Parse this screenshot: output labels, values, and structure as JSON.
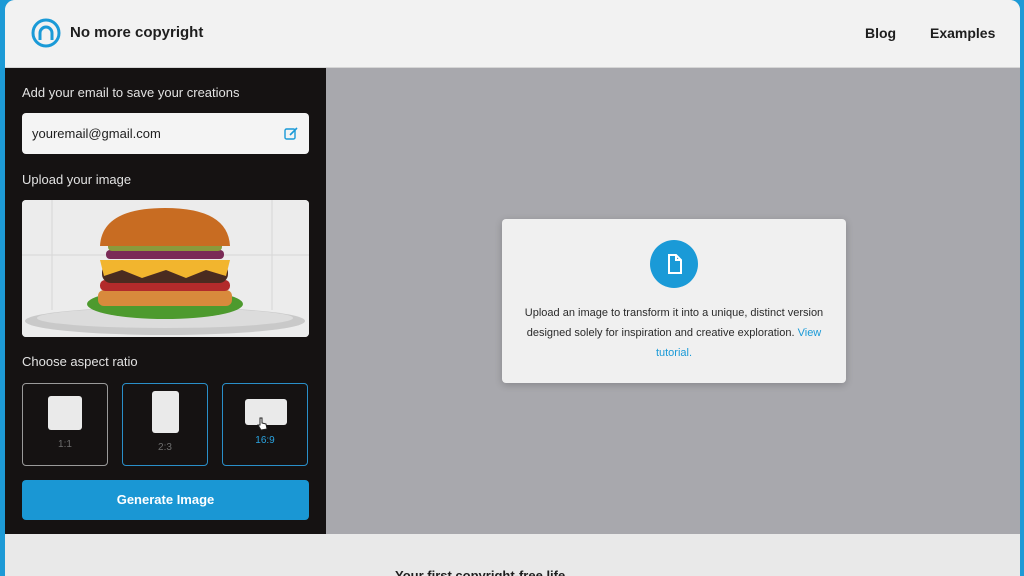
{
  "header": {
    "brand": "No more copyright",
    "nav": [
      "Blog",
      "Examples"
    ]
  },
  "sidebar": {
    "email_label": "Add your email to save your creations",
    "email_value": "youremail@gmail.com",
    "upload_label": "Upload your image",
    "ratio_label": "Choose aspect ratio",
    "ratios": [
      "1:1",
      "2:3",
      "16:9"
    ],
    "generate_label": "Generate Image"
  },
  "main": {
    "card_text": "Upload an image to transform it into a unique, distinct version designed solely for inspiration and creative exploration.",
    "card_link": "View tutorial."
  },
  "footer": {
    "partial_text": "Your first copyright-free life..."
  },
  "colors": {
    "accent": "#1a9ad7",
    "sidebar_bg": "#151212",
    "main_bg": "#a8a8ad"
  }
}
